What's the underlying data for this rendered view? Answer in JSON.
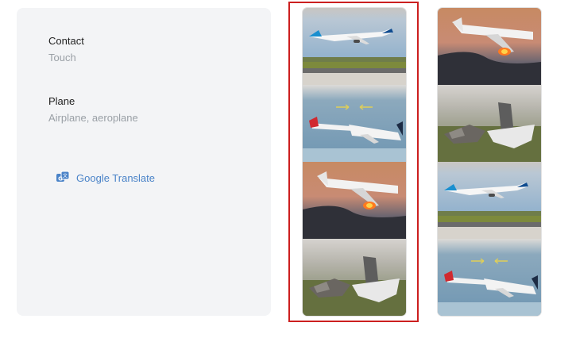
{
  "dictionary": {
    "entries": [
      {
        "word": "Contact",
        "translation": "Touch"
      },
      {
        "word": "Plane",
        "translation": "Airplane, aeroplane"
      }
    ],
    "translate_link": {
      "label": "Google Translate",
      "icon": "translate-icon"
    }
  },
  "image_strips": [
    {
      "selected": true,
      "tiles": [
        "takeoff",
        "two-planes",
        "burning",
        "wreck"
      ]
    },
    {
      "selected": false,
      "tiles": [
        "burning",
        "wreck",
        "takeoff",
        "two-planes"
      ]
    }
  ],
  "colors": {
    "highlight": "#cc1f1f",
    "link": "#4a83c8",
    "card": "#f3f4f6"
  }
}
